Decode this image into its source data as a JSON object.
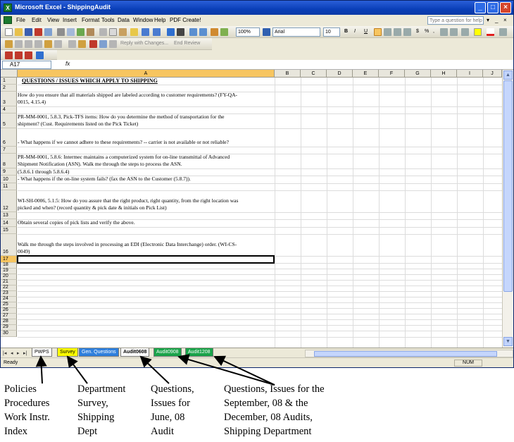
{
  "window": {
    "title": "Microsoft Excel - ShippingAudit",
    "controls": {
      "minimize": "_",
      "maximize": "□",
      "close": "×"
    }
  },
  "menu": {
    "items": [
      "File",
      "Edit",
      "View",
      "Insert",
      "Format",
      "Tools",
      "Data",
      "Window",
      "Help",
      "PDF Create!"
    ],
    "help_placeholder": "Type a question for help",
    "doc_controls": [
      "▾",
      "_",
      "×"
    ]
  },
  "toolbar": {
    "zoom": "100%",
    "font_name": "Arial",
    "font_size": "10",
    "bold": "B",
    "italic": "I",
    "underline": "U",
    "currency": "$",
    "percent": "%",
    "comma": ",",
    "reply_text": "Reply with Changes...",
    "end_review": "End Review"
  },
  "formula_bar": {
    "name_box": "A17",
    "fx": "fx",
    "formula": ""
  },
  "grid": {
    "columns": [
      "A",
      "B",
      "C",
      "D",
      "E",
      "F",
      "G",
      "H",
      "I",
      "J"
    ],
    "selected_column": "A",
    "row_numbers": [
      "1",
      "2",
      "3",
      "4",
      "5",
      "6",
      "7",
      "8",
      "9",
      "10",
      "11",
      "12",
      "13",
      "14",
      "15",
      "16",
      "17",
      "18",
      "19",
      "20",
      "21",
      "22",
      "23",
      "24",
      "25",
      "26",
      "27",
      "28",
      "29",
      "30"
    ],
    "selected_row": "17",
    "cells": {
      "r1": "QUESTIONS / ISSUES WHICH APPLY TO SHIPPING",
      "r3a": "How do you ensure that all materials shipped are labeled according to customer requirements?  (FY-QA-",
      "r3b": "0015, 4.15.4)",
      "r5a": "PR-MM-0001, 5.8.3, Pick-TFS items: How do you determine the method of transportation for the",
      "r5b": "shipment? (Cust. Requirements listed on the Pick Ticket)",
      "r6": "-    What happens if we cannot adhere to these requirements? -- carrier is not available or not reliable?",
      "r8a": "PR-MM-0001, 5.8.6: Intermec maintains a computerized system for on-line transmittal of Advanced",
      "r8b": "Shipment Notification (ASN). Walk me through the steps to process the ASN.",
      "r9": "(5.8.6.1 through 5.8.6.4)",
      "r10": "- What happens if the on-line system fails? (fax the ASN to the Customer (5.8.7)).",
      "r12a": "WI-SH-0006, 5.1.5: How do you assure that the right product, right quantity, from the right location was",
      "r12b": "picked and when? (record quantity & pick date & initials on Pick List)",
      "r14": "Obtain several copies of pick lists and verify the above.",
      "r16a": "Walk me through the steps involved in processing an EDI (Electronic Data Interchange) order.  (WI-CS-",
      "r16b": "0049)"
    }
  },
  "sheet_tabs": [
    {
      "label": "PWPS",
      "color": "#ffffff"
    },
    {
      "label": "Survey",
      "color": "#ffff00"
    },
    {
      "label": "Gen. Questions",
      "color": "#2f7fdc"
    },
    {
      "label": "Audit0608",
      "color": "#ffffff"
    },
    {
      "label": "Audit0908",
      "color": "#1aa34a"
    },
    {
      "label": "Audit1208",
      "color": "#1aa34a"
    }
  ],
  "nav_buttons": [
    "|◂",
    "◂",
    "▸",
    "▸|"
  ],
  "status": {
    "ready": "Ready",
    "num": "NUM"
  },
  "annotations": [
    {
      "text": "Policies\nProcedures\nWork Instr.\nIndex"
    },
    {
      "text": "Department\nSurvey,\nShipping\nDept"
    },
    {
      "text": "Questions,\nIssues for\nJune, 08\nAudit"
    },
    {
      "text": "Questions, Issues for the\nSeptember, 08 & the\nDecember, 08 Audits,\nShipping Department"
    }
  ]
}
